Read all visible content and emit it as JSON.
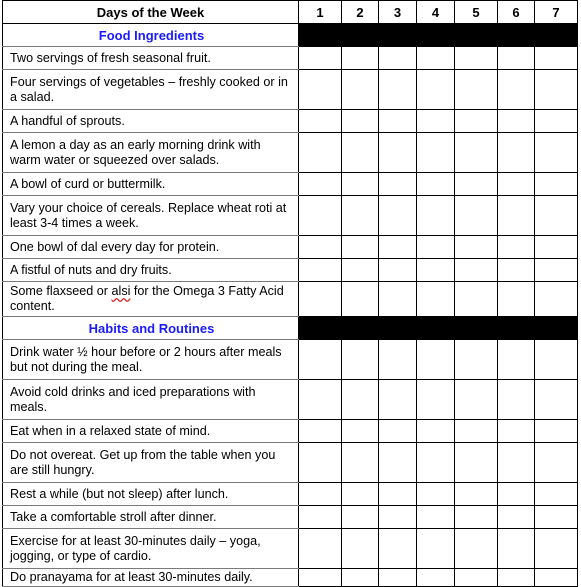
{
  "header": {
    "title": "Days of the Week",
    "days": [
      "1",
      "2",
      "3",
      "4",
      "5",
      "6",
      "7"
    ]
  },
  "sections": [
    {
      "title": "Food Ingredients",
      "items": [
        "Two servings of fresh seasonal fruit.",
        "Four servings of vegetables – freshly cooked or in a salad.",
        "A handful of sprouts.",
        "A lemon a day as an early morning drink with warm water or squeezed over salads.",
        "A bowl of curd or buttermilk.",
        "Vary your choice of cereals. Replace wheat roti at least 3-4 times a week.",
        "One bowl of dal every day for protein.",
        "A fistful of nuts and dry fruits.",
        "Some flaxseed or alsi for the Omega 3 Fatty Acid content."
      ]
    },
    {
      "title": "Habits and Routines",
      "items": [
        "Drink water ½ hour before or 2 hours after meals but not during the meal.",
        "Avoid cold drinks and iced preparations with meals.",
        "Eat when in a relaxed state of mind.",
        "Do not overeat. Get up from the table when you are still hungry.",
        "Rest a while (but not sleep) after lunch.",
        "Take a comfortable stroll after dinner.",
        "Exercise for at least 30-minutes daily – yoga, jogging, or type of cardio.",
        "Do pranayama for at least 30-minutes daily."
      ]
    }
  ],
  "colors": {
    "section_title": "#1a1aff",
    "section_bar": "#000000"
  }
}
